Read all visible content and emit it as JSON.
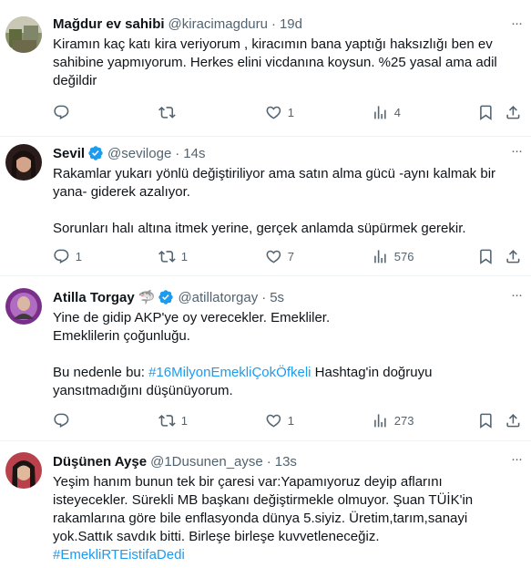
{
  "tweets": [
    {
      "name": "Mağdur ev sahibi",
      "handle": "@kiracimagduru",
      "time": "19d",
      "verified": false,
      "lines": [
        "Kiramın kaç katı kira veriyorum , kiracımın bana yaptığı haksızlığı ben ev",
        "sahibine yapmıyorum. Herkes elini vicdanına koysun. %25 yasal ama adil",
        "değildir"
      ],
      "replies": "",
      "retweets": "",
      "likes": "1",
      "views": "4"
    },
    {
      "name": "Sevil",
      "handle": "@seviloge",
      "time": "14s",
      "verified": true,
      "lines": [
        "Rakamlar yukarı yönlü değiştiriliyor ama satın alma gücü -aynı kalmak bir",
        "yana- giderek azalıyor.",
        "",
        "Sorunları halı altına itmek yerine, gerçek anlamda süpürmek gerekir."
      ],
      "replies": "1",
      "retweets": "1",
      "likes": "7",
      "views": "576"
    },
    {
      "name": "Atilla Torgay",
      "name_emoji": "🦈",
      "handle": "@atillatorgay",
      "time": "5s",
      "verified": true,
      "lines": [
        "Yine de gidip AKP'ye oy verecekler. Emekliler.",
        "Emeklilerin çoğunluğu.",
        "",
        "Bu nedenle bu: ",
        "yansıtmadığını düşünüyorum."
      ],
      "hashtag": "#16MilyonEmekliÇokÖfkeli",
      "hashtag_suffix": " Hashtag'in doğruyu",
      "replies": "",
      "retweets": "1",
      "likes": "1",
      "views": "273"
    },
    {
      "name": "Düşünen Ayşe",
      "handle": "@1Dusunen_ayse",
      "time": "13s",
      "verified": false,
      "lines": [
        "Yeşim hanım bunun tek bir çaresi var:Yapamıyoruz deyip aflarını",
        "isteyecekler. Sürekli MB başkanı değiştirmekle olmuyor. Şuan TÜİK'in",
        "rakamlarına göre bile enflasyonda dünya 5.siyiz. Üretim,tarım,sanayi",
        "yok.Sattık savdık bitti. Birleşe birleşe kuvvetleneceğiz."
      ],
      "hashtag": "#EmekliRTEistifaDedi"
    }
  ],
  "colors": {
    "text": "#0f1419",
    "muted": "#536471",
    "link": "#1d9bf0",
    "divider": "#eff3f4"
  },
  "icons": [
    "reply-icon",
    "retweet-icon",
    "like-icon",
    "views-icon",
    "bookmark-icon",
    "share-icon",
    "more-icon",
    "verified-badge-icon"
  ]
}
